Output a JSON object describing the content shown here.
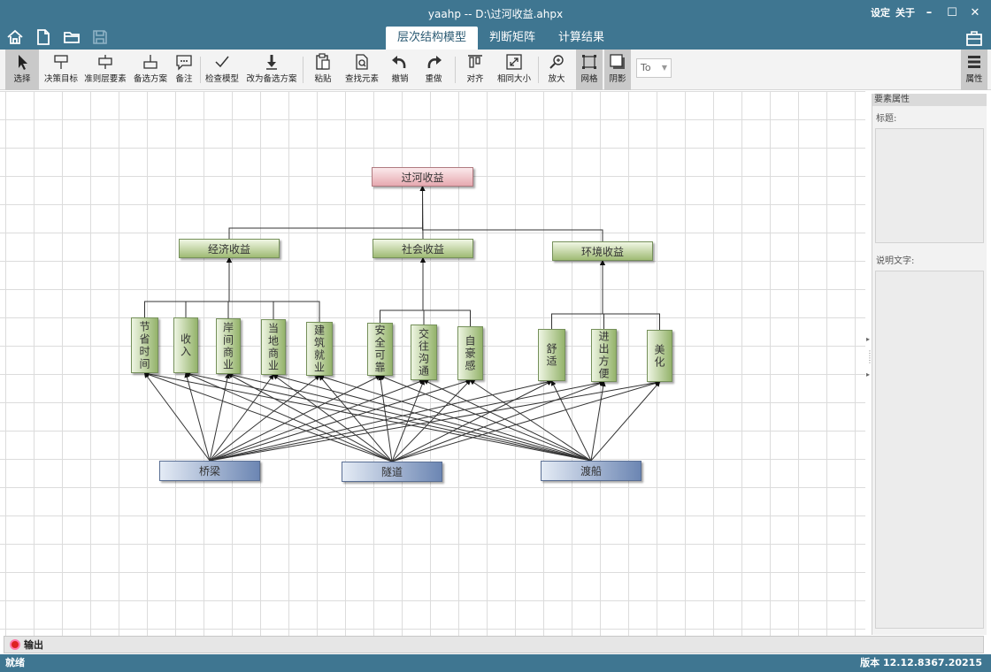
{
  "window": {
    "title": "yaahp -- D:\\过河收益.ahpx",
    "settings_label": "设定",
    "about_label": "关于",
    "minimize": "–",
    "maximize": "☐",
    "close": "✕"
  },
  "tabs": [
    {
      "label": "层次结构模型",
      "active": true
    },
    {
      "label": "判断矩阵",
      "active": false
    },
    {
      "label": "计算结果",
      "active": false
    }
  ],
  "toolbar": {
    "select": "选择",
    "decision_goal": "决策目标",
    "criteria_element": "准则层要素",
    "alternative": "备选方案",
    "note": "备注",
    "check_model": "检查模型",
    "to_alternative": "改为备选方案",
    "paste": "粘贴",
    "find_element": "查找元素",
    "undo": "撤销",
    "redo": "重做",
    "align": "对齐",
    "same_size": "相同大小",
    "zoom": "放大",
    "grid": "网格",
    "shadow": "阴影",
    "combo_value": "To",
    "properties": "属性"
  },
  "model": {
    "goal": "过河收益",
    "criteria": [
      "经济收益",
      "社会收益",
      "环境收益"
    ],
    "subcriteria": [
      "节省时间",
      "收入",
      "岸间商业",
      "当地商业",
      "建筑就业",
      "安全可靠",
      "交往沟通",
      "自豪感",
      "舒适",
      "进出方便",
      "美化"
    ],
    "alternatives": [
      "桥梁",
      "隧道",
      "渡船"
    ]
  },
  "properties_panel": {
    "header": "要素属性",
    "title_label": "标题:",
    "desc_label": "说明文字:"
  },
  "output": {
    "label": "输出"
  },
  "status": {
    "left": "就绪",
    "right": "版本 12.12.8367.20215"
  }
}
